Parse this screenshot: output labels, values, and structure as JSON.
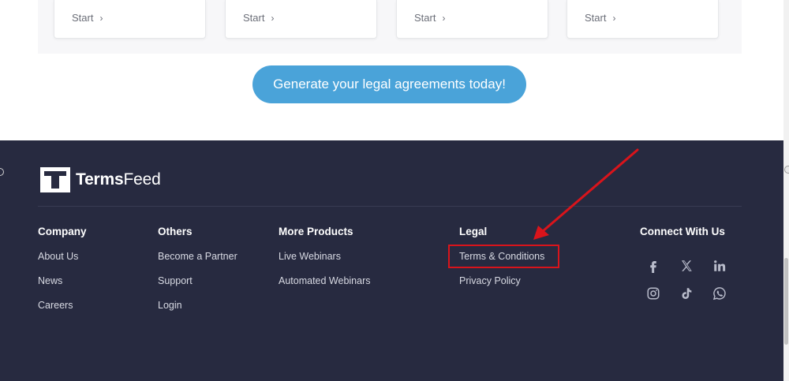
{
  "cards": [
    {
      "label": "Start"
    },
    {
      "label": "Start"
    },
    {
      "label": "Start"
    },
    {
      "label": "Start"
    }
  ],
  "cta": {
    "label": "Generate your legal agreements today!"
  },
  "footer": {
    "logo": {
      "text_bold": "Terms",
      "text_regular": "Feed",
      "icon": "termsfeed-logo"
    },
    "columns": {
      "company": {
        "title": "Company",
        "links": [
          "About Us",
          "News",
          "Careers"
        ]
      },
      "others": {
        "title": "Others",
        "links": [
          "Become a Partner",
          "Support",
          "Login"
        ]
      },
      "more_products": {
        "title": "More Products",
        "links": [
          "Live Webinars",
          "Automated Webinars"
        ]
      },
      "legal": {
        "title": "Legal",
        "links": [
          "Terms & Conditions",
          "Privacy Policy"
        ]
      },
      "connect": {
        "title": "Connect With Us",
        "icons": [
          "facebook-icon",
          "x-twitter-icon",
          "linkedin-icon",
          "instagram-icon",
          "tiktok-icon",
          "whatsapp-icon"
        ]
      }
    }
  },
  "annotation": {
    "highlighted_link": "Terms & Conditions",
    "color": "#d9141b"
  },
  "colors": {
    "footer_bg": "#272a40",
    "cta_bg": "#4aa3d9",
    "annotation_red": "#d9141b"
  }
}
